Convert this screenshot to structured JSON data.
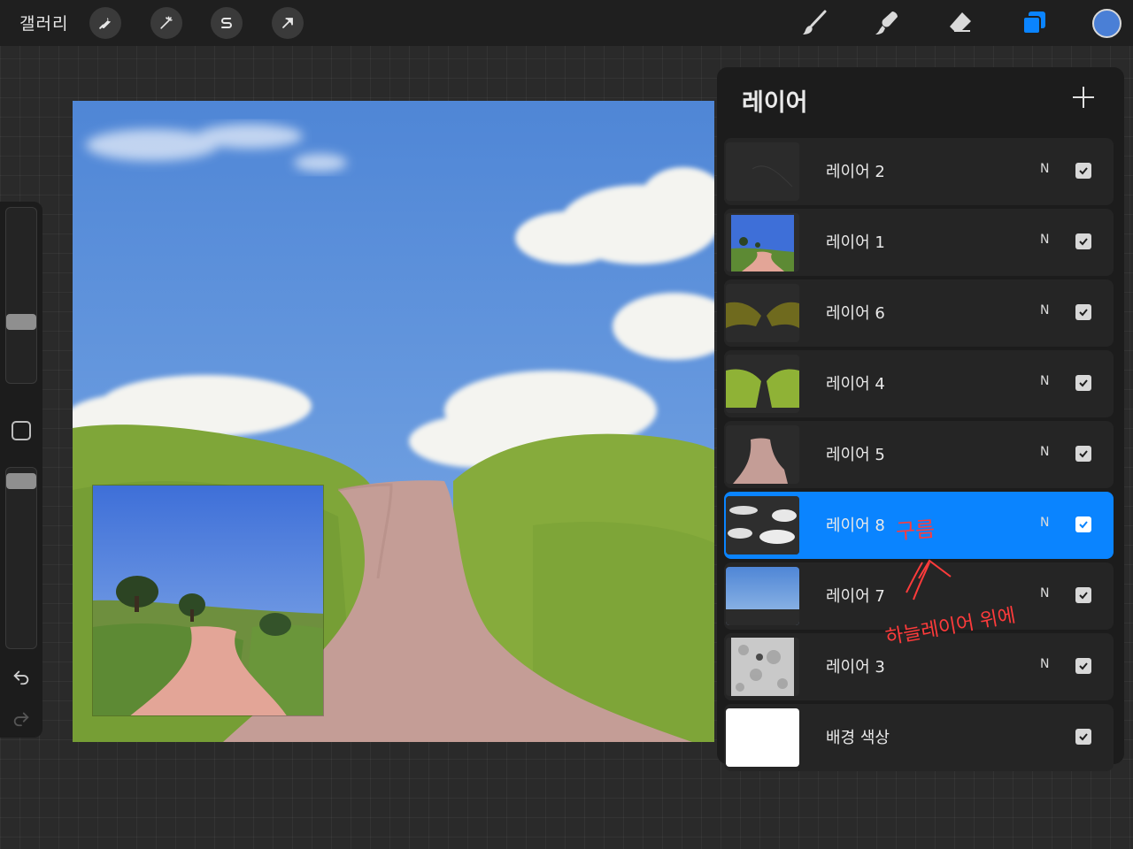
{
  "toolbar": {
    "gallery_label": "갤러리",
    "left_tools": [
      "wrench-icon",
      "magic-wand-icon",
      "selection-s-icon",
      "transform-arrow-icon"
    ],
    "right_tools": [
      "brush-icon",
      "smudge-icon",
      "eraser-icon",
      "layers-icon"
    ],
    "current_color": "#4a7fd6",
    "accent_color": "#0a84ff"
  },
  "layers_panel": {
    "title": "레이어",
    "add_label": "+",
    "layers": [
      {
        "name": "레이어 2",
        "blend": "N",
        "visible": true
      },
      {
        "name": "레이어 1",
        "blend": "N",
        "visible": true
      },
      {
        "name": "레이어 6",
        "blend": "N",
        "visible": true
      },
      {
        "name": "레이어 4",
        "blend": "N",
        "visible": true
      },
      {
        "name": "레이어 5",
        "blend": "N",
        "visible": true
      },
      {
        "name": "레이어 8",
        "blend": "N",
        "visible": true,
        "active": true
      },
      {
        "name": "레이어 7",
        "blend": "N",
        "visible": true
      },
      {
        "name": "레이어 3",
        "blend": "N",
        "visible": true
      },
      {
        "name": "배경 색상",
        "blend": "",
        "visible": true
      }
    ]
  },
  "annotation": {
    "cloud_note": "구름",
    "position_note": "하늘레이어 위에",
    "color": "#ff3b3b"
  }
}
